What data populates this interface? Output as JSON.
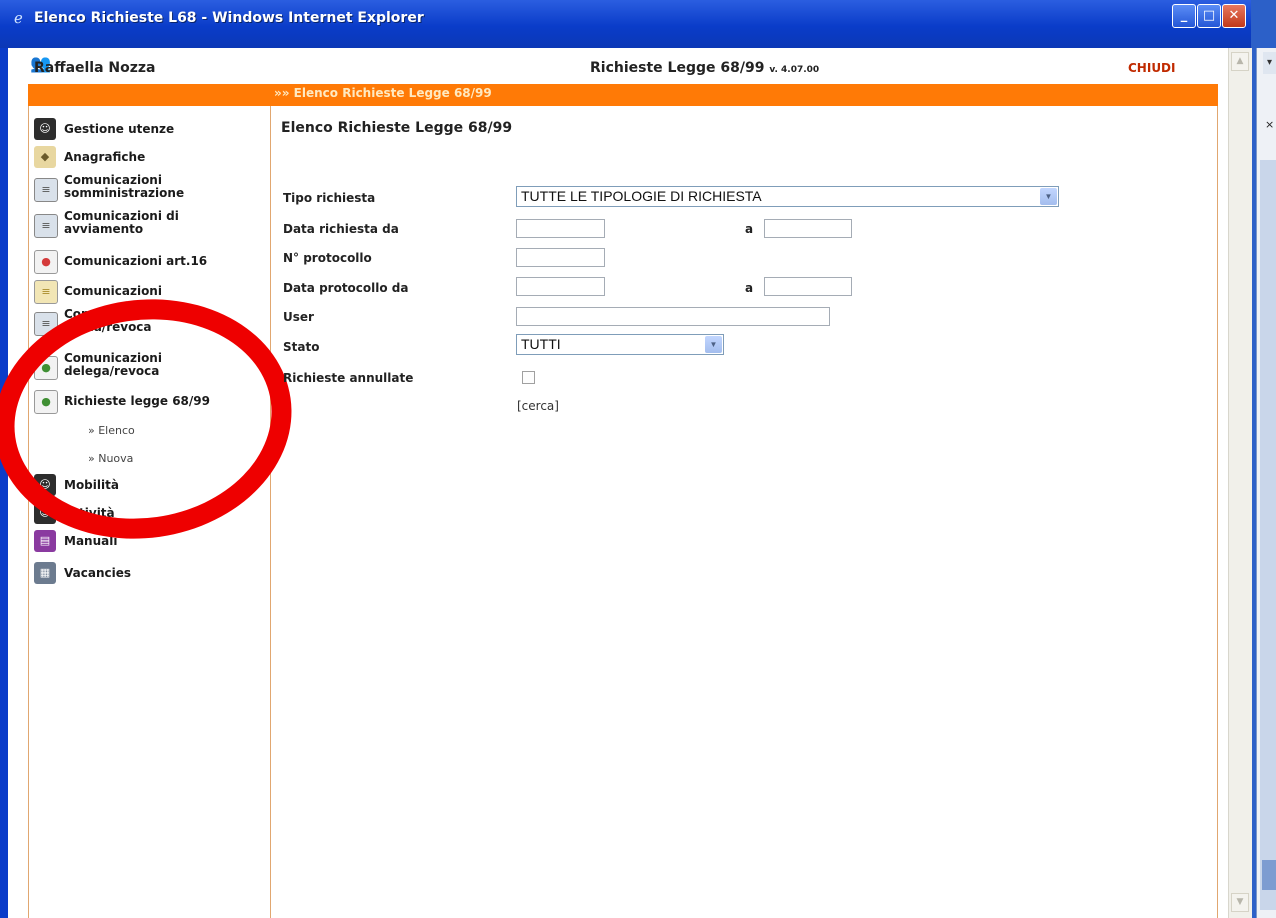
{
  "window": {
    "title": "Elenco Richieste L68 - Windows Internet Explorer",
    "controls": {
      "minimize": "_",
      "maximize": "□",
      "close": "✕"
    }
  },
  "header": {
    "user": "Raffaella Nozza",
    "app_title": "Richieste Legge 68/99",
    "app_version": "v. 4.07.00",
    "close_label": "CHIUDI"
  },
  "breadcrumb": "»» Elenco Richieste Legge 68/99",
  "sidebar": {
    "items": [
      {
        "label_lines": [
          "Gestione utenze"
        ],
        "icon": "user-admin-icon",
        "color": "#2d2d2d"
      },
      {
        "label_lines": [
          "Anagrafiche"
        ],
        "icon": "card-icon",
        "color": "#e8d7a0"
      },
      {
        "label_lines": [
          "Comunicazioni",
          "somministrazione"
        ],
        "icon": "document-icon",
        "color": "#d9e1ea"
      },
      {
        "label_lines": [
          "Comunicazioni di",
          "avviamento"
        ],
        "icon": "document-icon",
        "color": "#d9e1ea"
      },
      {
        "label_lines": [
          "Comunicazioni art.16"
        ],
        "icon": "document-red-icon",
        "color": "#d43a3a"
      },
      {
        "label_lines": [
          "Comunicazioni"
        ],
        "icon": "document-yellow-icon",
        "color": "#dfc267"
      },
      {
        "label_lines": [
          "Comunicazioni",
          "affilia/revoca"
        ],
        "icon": "document-icon",
        "color": "#d9e1ea"
      },
      {
        "label_lines": [
          "Comunicazioni",
          "delega/revoca"
        ],
        "icon": "document-green-icon",
        "color": "#56a548"
      },
      {
        "label_lines": [
          "Richieste legge 68/99"
        ],
        "icon": "document-green-icon",
        "color": "#56a548"
      },
      {
        "label_lines": [
          "Mobilità"
        ],
        "icon": "user-admin-icon",
        "color": "#2d2d2d"
      },
      {
        "label_lines": [
          "Attività"
        ],
        "icon": "user-admin-icon",
        "color": "#2d2d2d"
      },
      {
        "label_lines": [
          "Manuali"
        ],
        "icon": "books-icon",
        "color": "#8a3aa0"
      },
      {
        "label_lines": [
          "Vacancies"
        ],
        "icon": "vacancies-icon",
        "color": "#6c7b8f"
      }
    ],
    "sub_items": [
      "» Elenco",
      "» Nuova"
    ]
  },
  "content": {
    "title": "Elenco Richieste Legge 68/99",
    "fields": {
      "tipo_richiesta": {
        "label": "Tipo richiesta",
        "value": "TUTTE LE TIPOLOGIE DI RICHIESTA"
      },
      "data_richiesta": {
        "label": "Data richiesta da",
        "from": "",
        "to_label": "a",
        "to": ""
      },
      "protocollo": {
        "label": "N° protocollo",
        "value": ""
      },
      "data_protocollo": {
        "label": "Data protocollo da",
        "from": "",
        "to_label": "a",
        "to": ""
      },
      "user": {
        "label": "User",
        "value": ""
      },
      "stato": {
        "label": "Stato",
        "value": "TUTTI"
      },
      "annullate": {
        "label": "Richieste annullate",
        "checked": false
      }
    },
    "search_link": "[cerca]"
  },
  "colors": {
    "orange_bar": "#ff7a06",
    "title_bar": "#0a3cc9",
    "close_text": "#c02a00",
    "annotation_circle": "#ee0000"
  }
}
